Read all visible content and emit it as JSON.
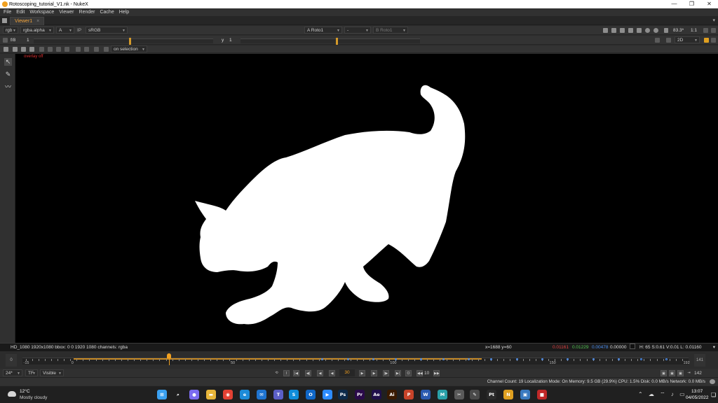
{
  "window": {
    "title": "Rotoscoping_tutorial_V1.nk - NukeX",
    "controls": [
      "—",
      "❐",
      "✕"
    ]
  },
  "menu": [
    "File",
    "Edit",
    "Workspace",
    "Viewer",
    "Render",
    "Cache",
    "Help"
  ],
  "viewer_tab": {
    "label": "Viewer1",
    "close": "×"
  },
  "toolbar1": {
    "channels": "rgb",
    "layer": "rgba.alpha",
    "display": "A",
    "ip": "IP",
    "colorspace": "sRGB",
    "input_a_label": "A",
    "input_a": "Roto1",
    "compare": "-",
    "input_b_label": "B",
    "input_b": "Roto1",
    "zoom": "83.3*",
    "proxy": "1:1"
  },
  "toolbar2": {
    "fstop": "f/8",
    "gain": "1",
    "gamma_label": "y",
    "gamma": "1",
    "view_mode": "2D"
  },
  "toolbar3": {
    "on_selection": "on selection"
  },
  "viewer": {
    "overlay_label": "overlay off",
    "background": "#000000",
    "matte_color": "#ffffff"
  },
  "infobar": {
    "format": "HD_1080 1920x1080  bbox: 0 0 1920 1080 channels: rgba",
    "coords": "x=1688 y=60",
    "r": "0.01161",
    "g": "0.01229",
    "b": "0.00478",
    "a": "0.00000",
    "hsv": "H: 65 S:0.61 V:0.01  L: 0.01160",
    "menu": "▾"
  },
  "timeline": {
    "start": "0",
    "end": "141",
    "labels": [
      {
        "text": "-15",
        "frame": -15
      },
      {
        "text": "0",
        "frame": 0
      },
      {
        "text": "50",
        "frame": 50
      },
      {
        "text": "100",
        "frame": 100
      },
      {
        "text": "150",
        "frame": 150
      },
      {
        "text": "192",
        "frame": 192
      }
    ],
    "range_min": -16,
    "range_max": 193,
    "current_frame": 30,
    "cached_to": 128,
    "keyframes": [
      78,
      86,
      94,
      101,
      109,
      116,
      124,
      131,
      139,
      147,
      155,
      163,
      171,
      178,
      186
    ]
  },
  "playback": {
    "fps": "24*",
    "tf": "TF",
    "visibility": "Visible",
    "current": "30",
    "step": "10",
    "end_frame": "142"
  },
  "status": {
    "text": "Channel Count: 19  Localization Mode: On  Memory: 9.5 GB (29.9%)  CPU: 1.5%  Disk: 0.0 MB/s  Network: 0.0 MB/s"
  },
  "taskbar": {
    "weather_temp": "12°C",
    "weather_desc": "Mostly cloudy",
    "apps": [
      {
        "name": "windows-start-icon",
        "label": "⊞",
        "color": "#3aa0f0"
      },
      {
        "name": "search-icon",
        "label": "⌕",
        "color": "#202020"
      },
      {
        "name": "chat-icon",
        "label": "●",
        "color": "#7b6cf0"
      },
      {
        "name": "file-explorer-icon",
        "label": "▬",
        "color": "#e8b63a"
      },
      {
        "name": "chrome-icon",
        "label": "◉",
        "color": "#e34133"
      },
      {
        "name": "edge-icon",
        "label": "e",
        "color": "#1d8bd8"
      },
      {
        "name": "mail-icon",
        "label": "✉",
        "color": "#1f74d0"
      },
      {
        "name": "teams-icon",
        "label": "T",
        "color": "#5b5fc7"
      },
      {
        "name": "skype-icon",
        "label": "S",
        "color": "#0f8ddb"
      },
      {
        "name": "outlook-icon",
        "label": "O",
        "color": "#1067c7"
      },
      {
        "name": "zoom-icon",
        "label": "▶",
        "color": "#2d8cff"
      },
      {
        "name": "photoshop-icon",
        "label": "Ps",
        "color": "#0c2a4a"
      },
      {
        "name": "premiere-icon",
        "label": "Pr",
        "color": "#2a0a4a"
      },
      {
        "name": "after-effects-icon",
        "label": "Ae",
        "color": "#1f0f4a"
      },
      {
        "name": "illustrator-icon",
        "label": "Ai",
        "color": "#3a1a00"
      },
      {
        "name": "powerpoint-icon",
        "label": "P",
        "color": "#c8442a"
      },
      {
        "name": "word-icon",
        "label": "W",
        "color": "#2a5ab0"
      },
      {
        "name": "maya-icon",
        "label": "M",
        "color": "#2aa0a8"
      },
      {
        "name": "snipping-icon",
        "label": "✂",
        "color": "#5a5a5a"
      },
      {
        "name": "paint-icon",
        "label": "✎",
        "color": "#4a4a4a"
      },
      {
        "name": "pt-icon",
        "label": "Pt",
        "color": "#2a2a2a"
      },
      {
        "name": "nuke-icon",
        "label": "N",
        "color": "#e0a020"
      },
      {
        "name": "app-icon",
        "label": "▣",
        "color": "#3a7ac0"
      },
      {
        "name": "red-app-icon",
        "label": "■",
        "color": "#c02828"
      }
    ],
    "tray": "⌃ ☁ ⌔ ♪ ▭",
    "time": "13:07",
    "date": "04/05/2022",
    "notification": "❏"
  }
}
